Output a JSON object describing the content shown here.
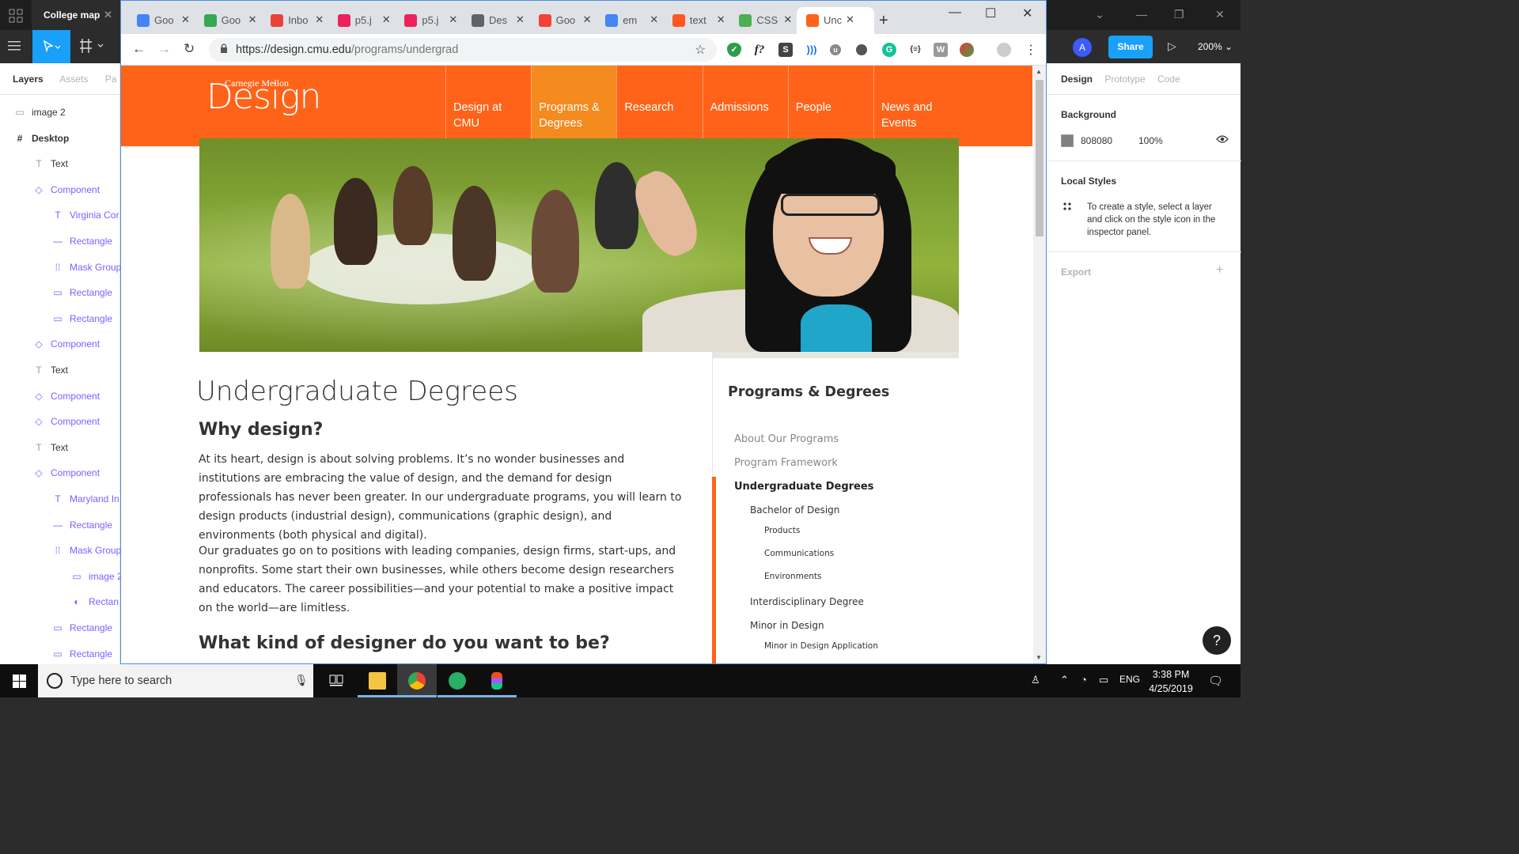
{
  "figma": {
    "file_tab": "College map",
    "zoom": "200%",
    "share_label": "Share",
    "avatar_initial": "A",
    "layers_tabs": [
      "Layers",
      "Assets",
      "Pa"
    ],
    "layers": [
      {
        "name": "image 2",
        "kind": "image"
      },
      {
        "name": "Desktop",
        "kind": "frame"
      },
      {
        "name": "Text",
        "kind": "text"
      },
      {
        "name": "Component",
        "kind": "component"
      },
      {
        "name": "Virginia Cor",
        "kind": "text-comp"
      },
      {
        "name": "Rectangle",
        "kind": "line-comp"
      },
      {
        "name": "Mask Group",
        "kind": "mask-comp"
      },
      {
        "name": "Rectangle",
        "kind": "rect-comp"
      },
      {
        "name": "Rectangle",
        "kind": "rect-comp"
      },
      {
        "name": "Component",
        "kind": "component"
      },
      {
        "name": "Text",
        "kind": "text"
      },
      {
        "name": "Component",
        "kind": "component"
      },
      {
        "name": "Component",
        "kind": "component"
      },
      {
        "name": "Text",
        "kind": "text"
      },
      {
        "name": "Component",
        "kind": "component"
      },
      {
        "name": "Maryland In",
        "kind": "text-comp"
      },
      {
        "name": "Rectangle",
        "kind": "line-comp"
      },
      {
        "name": "Mask Group",
        "kind": "mask-comp"
      },
      {
        "name": "image 2",
        "kind": "image-comp"
      },
      {
        "name": "Rectan",
        "kind": "ellipse-comp"
      },
      {
        "name": "Rectangle",
        "kind": "rect-comp"
      },
      {
        "name": "Rectangle",
        "kind": "rect-comp"
      }
    ],
    "inspector": {
      "tabs": [
        "Design",
        "Prototype",
        "Code"
      ],
      "background_title": "Background",
      "background_hex": "808080",
      "background_opacity": "100%",
      "local_styles_title": "Local Styles",
      "local_styles_hint": "To create a style, select a layer and click on the style icon in the inspector panel.",
      "export_title": "Export",
      "help": "?"
    }
  },
  "chrome": {
    "tabs": [
      {
        "label": "Goo",
        "icon": "google-docs-icon",
        "color": "#4285f4"
      },
      {
        "label": "Goo",
        "icon": "google-maps-icon",
        "color": "#34a853"
      },
      {
        "label": "Inbo",
        "icon": "gmail-icon",
        "color": "#ea4335"
      },
      {
        "label": "p5.j",
        "icon": "p5-icon",
        "color": "#ed225d"
      },
      {
        "label": "p5.j",
        "icon": "p5-icon",
        "color": "#ed225d"
      },
      {
        "label": "Des",
        "icon": "globe-icon",
        "color": "#5f6368"
      },
      {
        "label": "Goo",
        "icon": "google-fonts-icon",
        "color": "#f44336"
      },
      {
        "label": "em",
        "icon": "google-icon",
        "color": "#4285f4"
      },
      {
        "label": "text",
        "icon": "pinwheel-icon",
        "color": "#ff5722"
      },
      {
        "label": "CSS",
        "icon": "w3-icon",
        "color": "#4caf50"
      },
      {
        "label": "Unc",
        "icon": "cmu-icon",
        "color": "#ff6319"
      }
    ],
    "url_host": "https://design.cmu.edu",
    "url_path": "/programs/undergrad"
  },
  "site": {
    "logo_small": "Carnegie Mellon",
    "logo_big": "Design",
    "nav": [
      {
        "line1": "Design at",
        "line2": "CMU"
      },
      {
        "line1": "Programs &",
        "line2": "Degrees"
      },
      {
        "line1": "Research",
        "line2": ""
      },
      {
        "line1": "Admissions",
        "line2": ""
      },
      {
        "line1": "People",
        "line2": ""
      },
      {
        "line1": "News and",
        "line2": "Events"
      }
    ],
    "page_title": "Undergraduate Degrees",
    "why_heading": "Why design?",
    "why_p1": "At its heart, design is about solving problems. It’s no wonder businesses and institutions are embracing the value of design, and the demand for design professionals has never been greater. In our undergraduate programs, you will learn to design products (industrial design), communications (graphic design), and environments (both physical and digital).",
    "why_p2": "Our graduates go on to positions with leading companies, design firms, start-ups, and nonprofits. Some start their own businesses, while others become design researchers and educators. The career possibilities—and your potential to make a positive impact on the world—are limitless.",
    "kind_heading": "What kind of designer do you want to be?",
    "sidebar_title": "Programs & Degrees",
    "sidebar_links": [
      {
        "label": "About Our Programs",
        "level": 1
      },
      {
        "label": "Program Framework",
        "level": 1
      },
      {
        "label": "Undergraduate Degrees",
        "level": 1,
        "current": true
      },
      {
        "label": "Bachelor of Design",
        "level": 2
      },
      {
        "label": "Products",
        "level": 3
      },
      {
        "label": "Communications",
        "level": 3
      },
      {
        "label": "Environments",
        "level": 3
      },
      {
        "label": "Interdisciplinary Degree",
        "level": 2
      },
      {
        "label": "Minor in Design",
        "level": 2
      },
      {
        "label": "Minor in Design Application",
        "level": 3
      }
    ]
  },
  "taskbar": {
    "search_placeholder": "Type here to search",
    "language": "ENG",
    "time": "3:38 PM",
    "date": "4/25/2019"
  }
}
